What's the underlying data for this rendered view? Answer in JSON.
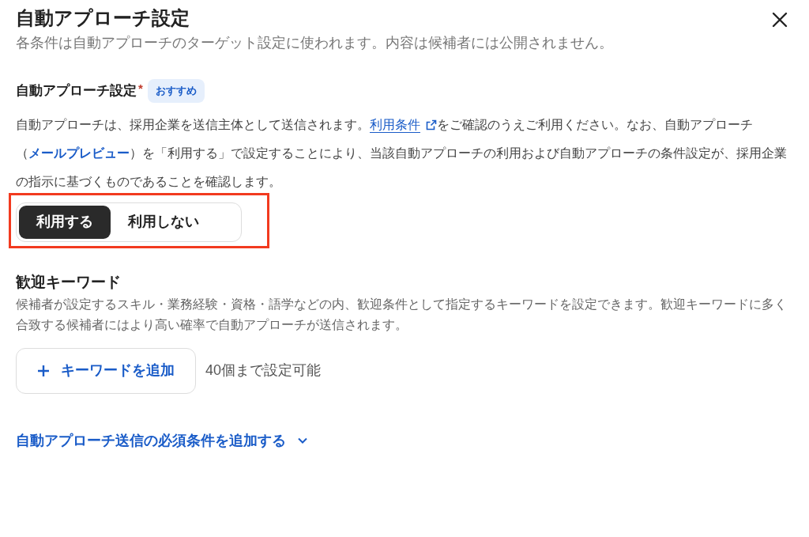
{
  "header": {
    "title": "自動アプローチ設定",
    "subtitle": "各条件は自動アプローチのターゲット設定に使われます。内容は候補者には公開されません。"
  },
  "auto_approach": {
    "label": "自動アプローチ設定",
    "required_mark": "*",
    "badge": "おすすめ",
    "description": {
      "before": "自動アプローチは、採用企業を送信主体として送信されます。",
      "terms_link": "利用条件",
      "middle": "をご確認のうえご利用ください。なお、自動アプローチ（",
      "preview_link": "メールプレビュー",
      "after": "）を「利用する」で設定することにより、当該自動アプローチの利用および自動アプローチの条件設定が、採用企業の指示に基づくものであることを確認します。"
    },
    "options": [
      {
        "label": "利用する",
        "selected": true
      },
      {
        "label": "利用しない",
        "selected": false
      }
    ],
    "highlighted": true
  },
  "keywords": {
    "title": "歓迎キーワード",
    "description": "候補者が設定するスキル・業務経験・資格・語学などの内、歓迎条件として指定するキーワードを設定できます。歓迎キーワードに多く合致する候補者にはより高い確率で自動アプローチが送信されます。",
    "add_button": "キーワードを追加",
    "limit_note": "40個まで設定可能"
  },
  "required_conditions_link": {
    "label": "自動アプローチ送信の必須条件を追加する",
    "expanded": false
  }
}
